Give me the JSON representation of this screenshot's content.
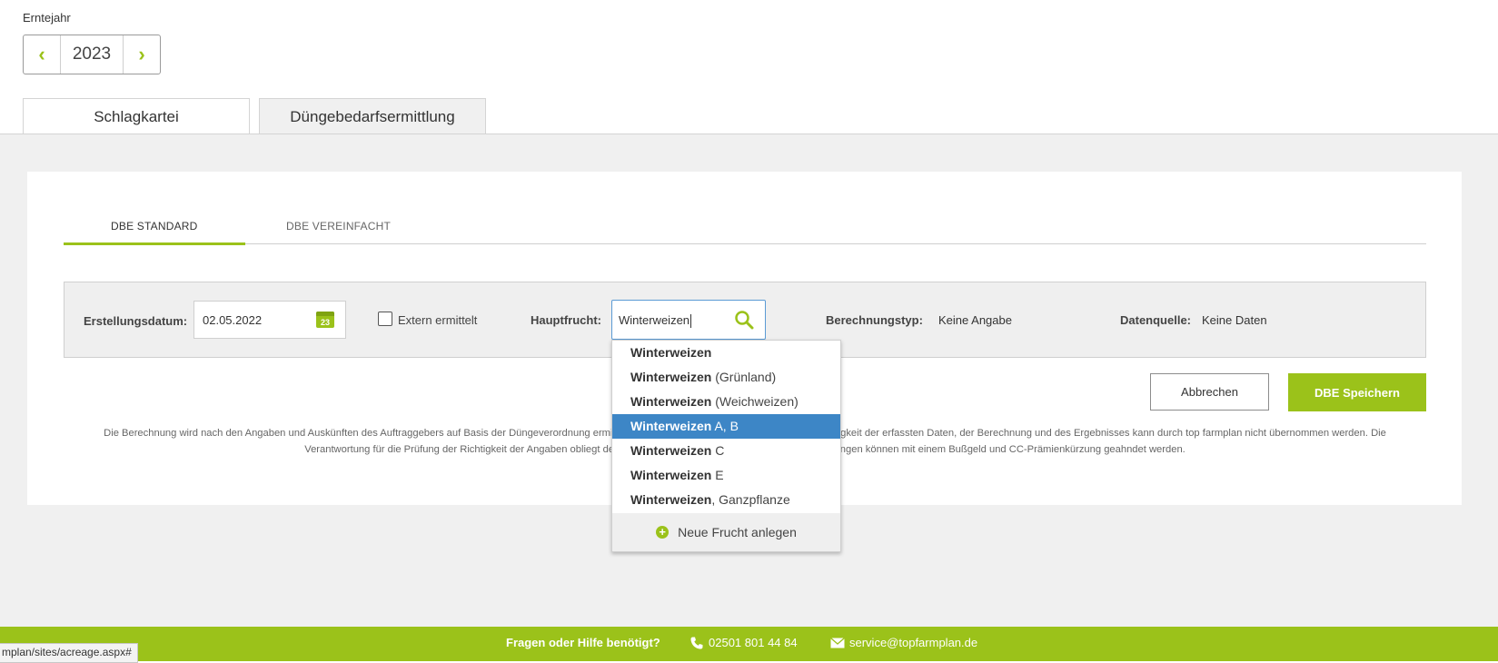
{
  "year_selector": {
    "label": "Erntejahr",
    "value": "2023",
    "prev": "‹",
    "next": "›"
  },
  "main_tabs": [
    "Schlagkartei",
    "Düngebedarfsermittlung"
  ],
  "sub_tabs": [
    "DBE STANDARD",
    "DBE VEREINFACHT"
  ],
  "form": {
    "created_label": "Erstellungsdatum:",
    "created_value": "02.05.2022",
    "calendar_day": "23",
    "external_label": "Extern ermittelt",
    "main_crop_label": "Hauptfrucht:",
    "main_crop_value": "Winterweizen",
    "calc_type_label": "Berechnungstyp:",
    "calc_type_value": "Keine Angabe",
    "source_label": "Datenquelle:",
    "source_value": "Keine Daten"
  },
  "dropdown": {
    "items": [
      {
        "bold": "Winterweizen",
        "rest": ""
      },
      {
        "bold": "Winterweizen",
        "rest": " (Grünland)"
      },
      {
        "bold": "Winterweizen",
        "rest": " (Weichweizen)"
      },
      {
        "bold": "Winterweizen",
        "rest": " A, B"
      },
      {
        "bold": "Winterweizen",
        "rest": " C"
      },
      {
        "bold": "Winterweizen",
        "rest": " E"
      },
      {
        "bold": "Winterweizen",
        "rest": ", Ganzpflanze"
      }
    ],
    "new_label": "Neue Frucht anlegen"
  },
  "buttons": {
    "cancel": "Abbrechen",
    "save": "DBE Speichern"
  },
  "disclaimer": "Die Berechnung wird nach den Angaben und Auskünften des Auftraggebers auf Basis der Düngeverordnung ermittelt. Eine Haftung für die Vollständigkeit und Richtigkeit der erfassten Daten, der Berechnung und des Ergebnisses kann durch top farmplan nicht übernommen werden. Die Verantwortung für die Prüfung der Richtigkeit der Angaben obliegt dem Auftraggeber. Fehlerhafte Düngebedarfsermittlungen können mit einem Bußgeld und CC-Prämienkürzung geahndet werden.",
  "footer": {
    "question": "Fragen oder Hilfe benötigt?",
    "phone": "02501 801 44 84",
    "email": "service@topfarmplan.de"
  },
  "status_url": "mplan/sites/acreage.aspx#",
  "colors": {
    "accent": "#9bc21a",
    "selected": "#3d86c6",
    "background": "#f0f0f0"
  }
}
